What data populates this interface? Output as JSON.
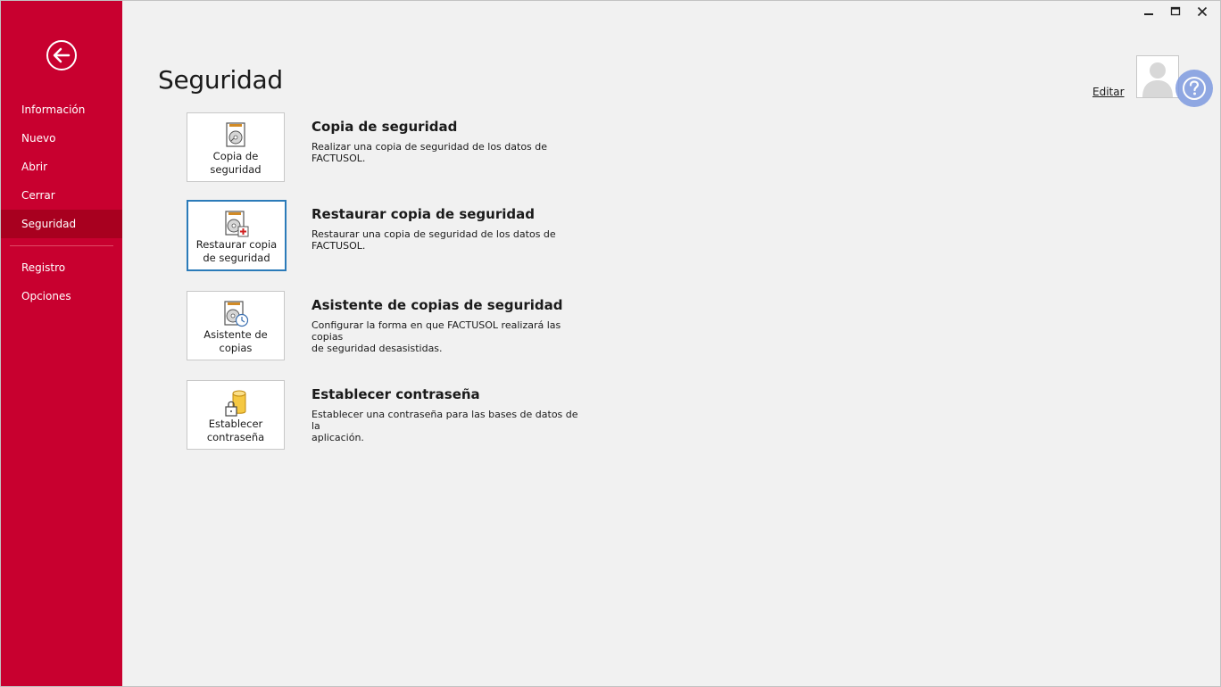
{
  "window": {
    "minimize_icon": "minimize-icon",
    "maximize_icon": "maximize-icon",
    "close_icon": "close-icon"
  },
  "sidebar": {
    "background": "#c8002f",
    "back_icon": "back-arrow-icon",
    "items": [
      {
        "label": "Información"
      },
      {
        "label": "Nuevo"
      },
      {
        "label": "Abrir"
      },
      {
        "label": "Cerrar"
      },
      {
        "label": "Seguridad",
        "active": true
      },
      {
        "label": "Registro"
      },
      {
        "label": "Opciones"
      }
    ]
  },
  "page": {
    "title": "Seguridad"
  },
  "user": {
    "edit_label": "Editar",
    "avatar_icon": "user-avatar-icon",
    "help_icon": "help-icon"
  },
  "actions": [
    {
      "tile_label_1": "Copia de",
      "tile_label_2": "seguridad",
      "title": "Copia de seguridad",
      "desc_1": "Realizar una copia de seguridad de los datos de",
      "desc_2": "FACTUSOL.",
      "icon": "backup-disk-icon"
    },
    {
      "tile_label_1": "Restaurar copia",
      "tile_label_2": "de seguridad",
      "title": "Restaurar copia de seguridad",
      "desc_1": "Restaurar una copia de seguridad de los datos de",
      "desc_2": "FACTUSOL.",
      "icon": "restore-disk-icon"
    },
    {
      "tile_label_1": "Asistente de",
      "tile_label_2": "copias",
      "title": "Asistente de copias de seguridad",
      "desc_1": "Configurar la forma en que FACTUSOL realizará las copias",
      "desc_2": "de seguridad desasistidas.",
      "icon": "backup-schedule-icon"
    },
    {
      "tile_label_1": "Establecer",
      "tile_label_2": "contraseña",
      "title": "Establecer contraseña",
      "desc_1": "Establecer una contraseña para las bases de datos de la",
      "desc_2": "aplicación.",
      "icon": "database-lock-icon"
    }
  ]
}
